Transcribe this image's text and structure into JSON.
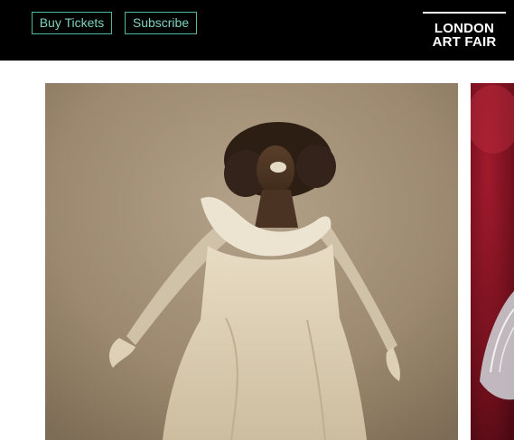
{
  "header": {
    "buy_tickets_label": "Buy Tickets",
    "subscribe_label": "Subscribe",
    "logo": {
      "line1": "LONDON",
      "line2": "ART FAIR"
    }
  },
  "colors": {
    "header_bg": "#000000",
    "button_border": "#4fb79f",
    "button_text": "#7fd3bf",
    "logo_text": "#ffffff",
    "page_bg": "#ffffff"
  },
  "gallery": {
    "main_image": "sepia-photograph-figure-in-white-dress",
    "side_image": "red-toned-photograph-partial"
  }
}
